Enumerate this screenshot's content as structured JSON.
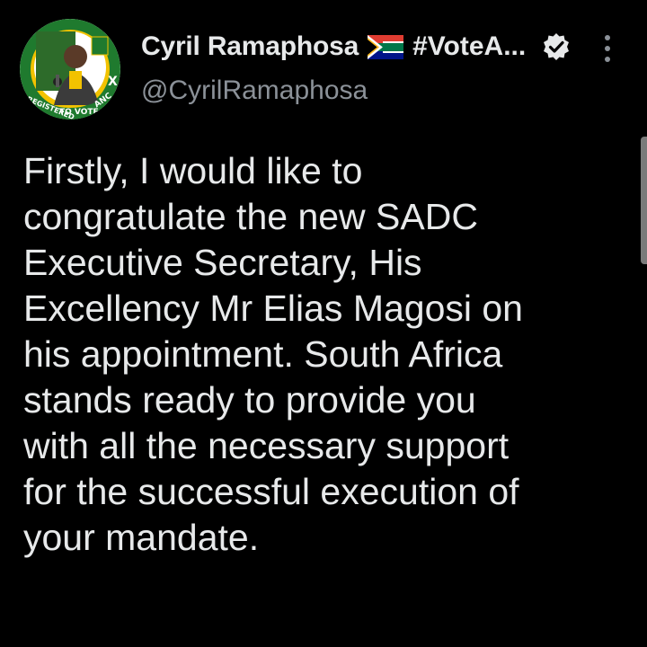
{
  "author": {
    "display_name": "Cyril Ramaphosa",
    "flag_icon": "south-africa-flag-icon",
    "hashtag_truncated": "#VoteA...",
    "handle": "@CyrilRamaphosa",
    "verified_icon": "verified-badge-icon",
    "avatar_badge_text": "REGISTERED TO VOTE ANC",
    "avatar_badge_lettering": "REGISTERED TO VOTE ANC"
  },
  "tweet": {
    "lines": [
      "Firstly, I would like to",
      "congratulate the new SADC",
      "Executive Secretary, His",
      "Excellency Mr Elias Magosi on",
      "his appointment. South Africa",
      "stands ready to provide you",
      "with all the necessary support",
      "for the successful execution of",
      "your mandate."
    ]
  },
  "menu": {
    "more_icon": "more-vertical-icon"
  },
  "colors": {
    "background": "#000000",
    "text": "#e7e9ea",
    "secondary_text": "#8b9198",
    "anc_green": "#1f7a2e",
    "anc_gold": "#f2c200"
  }
}
